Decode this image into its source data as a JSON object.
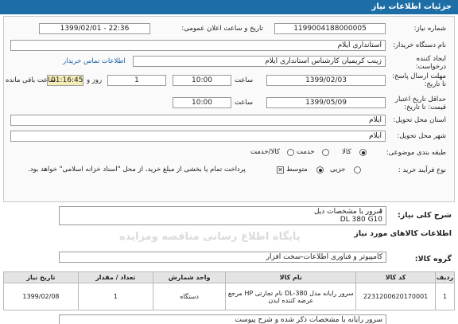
{
  "title": "جزئیات اطلاعات نیاز",
  "fields": {
    "need_number_label": "شماره نیاز:",
    "need_number": "1199004188000005",
    "announce_label": "تاریخ و ساعت اعلان عمومی:",
    "announce_value": "1399/02/01 - 22:36",
    "device_label": "نام دستگاه خریدار:",
    "device_value": "استانداری ایلام",
    "creator_label1": "ایجاد کننده",
    "creator_label2": "درخواست:",
    "creator_value": "زینب کریمیان کارشناس استانداری ایلام",
    "contact_link": "اطلاعات تماس خریدار",
    "deadline_label1": "مهلت ارسال پاسخ:",
    "deadline_label2": "تا تاریخ:",
    "deadline_date": "1399/02/03",
    "time_label": "ساعت",
    "deadline_time": "10:00",
    "days_value": "1",
    "days_label": "روز و",
    "remaining_value": "01:16:45",
    "remaining_label": "ساعت باقی مانده",
    "validity_label1": "حداقل تاریخ اعتبار",
    "validity_label2": "قیمت: تا تاریخ:",
    "validity_date": "1399/05/09",
    "validity_time": "10:00",
    "province_label": "استان محل تحویل:",
    "province_value": "ایلام",
    "city_label": "شهر محل تحویل:",
    "city_value": "ایلام",
    "category_label": "طبقه بندی موضوعی:",
    "category_options": [
      "کالا",
      "خدمت",
      "کالا/خدمت"
    ],
    "process_label": "نوع فرآیند خرید :",
    "process_options": [
      "جزیی",
      "متوسط"
    ],
    "payment_note": "پرداخت تمام یا بخشی از مبلغ خرید، از محل \"اسناد خزانه اسلامی\" خواهد بود."
  },
  "description": {
    "label": "شرح کلی نیاز:",
    "line1": "سرور با مشخصات دیل",
    "line2": "DL 380 G10"
  },
  "goods_header": "اطلاعات کالاهای مورد نیاز",
  "goods_group_label": "گروه کالا:",
  "goods_group_value": "کامپیوتر و فناوری اطلاعات-سخت افزار",
  "table": {
    "headers": [
      "ردیف",
      "کد کالا",
      "نام کالا",
      "واحد شمارش",
      "تعداد / مقدار",
      "تاریخ نیاز"
    ],
    "rows": [
      [
        "1",
        "2231200620170001",
        "سرور رایانه مدل DL-380 نام تجارتی HP مرجع عرضه کننده ایدن",
        "دستگاه",
        "1",
        "1399/02/08"
      ]
    ]
  },
  "bottom_note": "سرور رایانه با مشخصات ذکر شده و شرح پیوست",
  "watermark": {
    "line1": "پایگاه اطلاع رسانی مناقصه ومزایده",
    "line2": "۰۲۱-۸۸۳۴۹۶۷۰"
  }
}
